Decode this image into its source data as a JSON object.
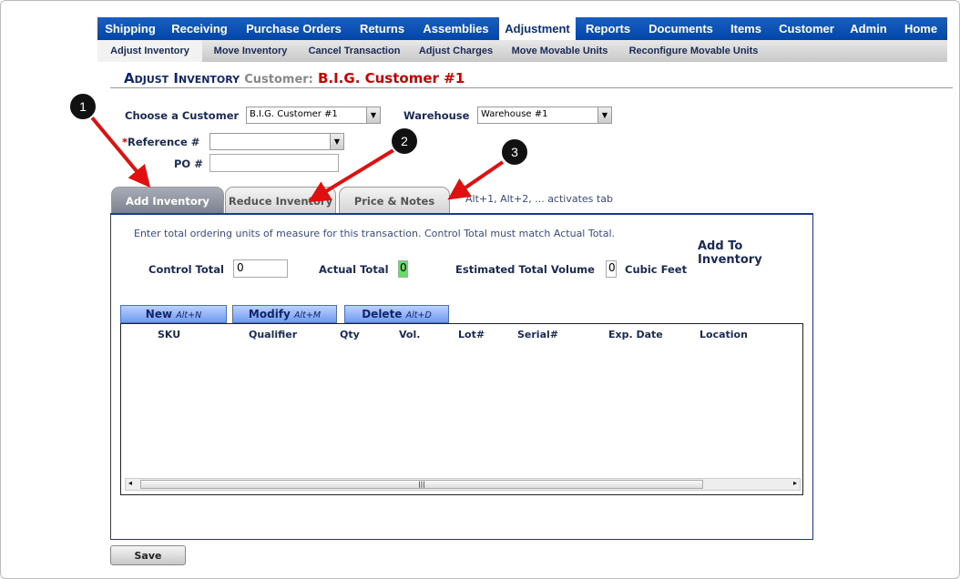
{
  "nav": {
    "items": [
      "Shipping",
      "Receiving",
      "Purchase Orders",
      "Returns",
      "Assemblies",
      "Adjustment",
      "Reports",
      "Documents",
      "Items",
      "Customer",
      "Admin",
      "Home"
    ],
    "active": "Adjustment"
  },
  "subnav": {
    "items": [
      "Adjust Inventory",
      "Move Inventory",
      "Cancel Transaction",
      "Adjust Charges",
      "Move Movable Units",
      "Reconfigure Movable Units"
    ],
    "active": "Adjust Inventory"
  },
  "page": {
    "title": "Adjust Inventory",
    "customer_label": "Customer:",
    "customer_value": "B.I.G. Customer #1"
  },
  "form": {
    "choose_customer_label": "Choose a Customer",
    "customer_select": "B.I.G. Customer #1",
    "warehouse_label": "Warehouse",
    "warehouse_select": "Warehouse #1",
    "reference_required": "*",
    "reference_label": "Reference #",
    "reference_value": "",
    "po_label": "PO #",
    "po_value": ""
  },
  "tabs": [
    {
      "label": "Add Inventory",
      "active": true
    },
    {
      "label": "Reduce Inventory"
    },
    {
      "label": "Price & Notes"
    }
  ],
  "tab_hint": "Alt+1, Alt+2, ... activates tab",
  "panel": {
    "instructions": "Enter total ordering units of measure for this transaction. Control Total must match Actual Total.",
    "control_total_label": "Control Total",
    "control_total_value": "0",
    "actual_total_label": "Actual Total",
    "actual_total_value": "0",
    "volume_label": "Estimated Total Volume",
    "volume_value": "0",
    "volume_unit": "Cubic Feet",
    "side_title": "Add To Inventory"
  },
  "buttons": [
    {
      "label": "New",
      "shortcut": "Alt+N"
    },
    {
      "label": "Modify",
      "shortcut": "Alt+M"
    },
    {
      "label": "Delete",
      "shortcut": "Alt+D"
    }
  ],
  "grid": {
    "columns": [
      "SKU",
      "Qualifier",
      "Qty",
      "Vol.",
      "Lot#",
      "Serial#",
      "Exp. Date",
      "Location"
    ],
    "rows": []
  },
  "save_label": "Save",
  "annotations": [
    "1",
    "2",
    "3"
  ],
  "colors": {
    "nav": "#0045a8",
    "required": "#c00",
    "actual_total_bg": "#66dd66",
    "arrow": "#e01010"
  }
}
